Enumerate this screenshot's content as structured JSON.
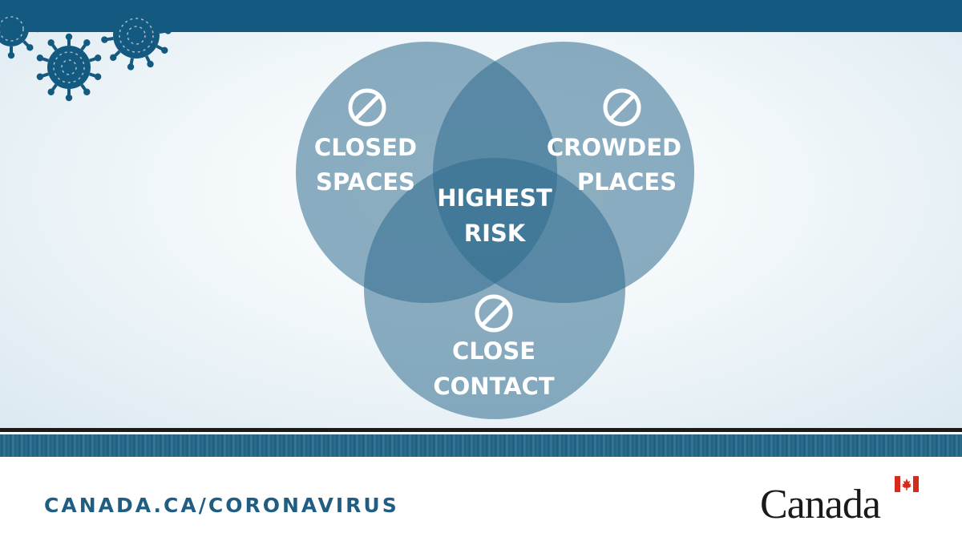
{
  "diagram": {
    "type": "venn",
    "circles": [
      {
        "label_line1": "CLOSED",
        "label_line2": "SPACES",
        "icon": "prohibited-icon"
      },
      {
        "label_line1": "CROWDED",
        "label_line2": "PLACES",
        "icon": "prohibited-icon"
      },
      {
        "label_line1": "CLOSE",
        "label_line2": "CONTACT",
        "icon": "prohibited-icon"
      }
    ],
    "center_label_line1": "HIGHEST",
    "center_label_line2": "RISK"
  },
  "footer": {
    "url": "CANADA.CA/CORONAVIRUS",
    "wordmark": "Canada"
  },
  "colors": {
    "brand_blue": "#145a80",
    "circle_fill": "#2f6b8e",
    "text_blue": "#1f5d82"
  },
  "decorations": [
    "virus-icon",
    "canada-flag-icon"
  ]
}
